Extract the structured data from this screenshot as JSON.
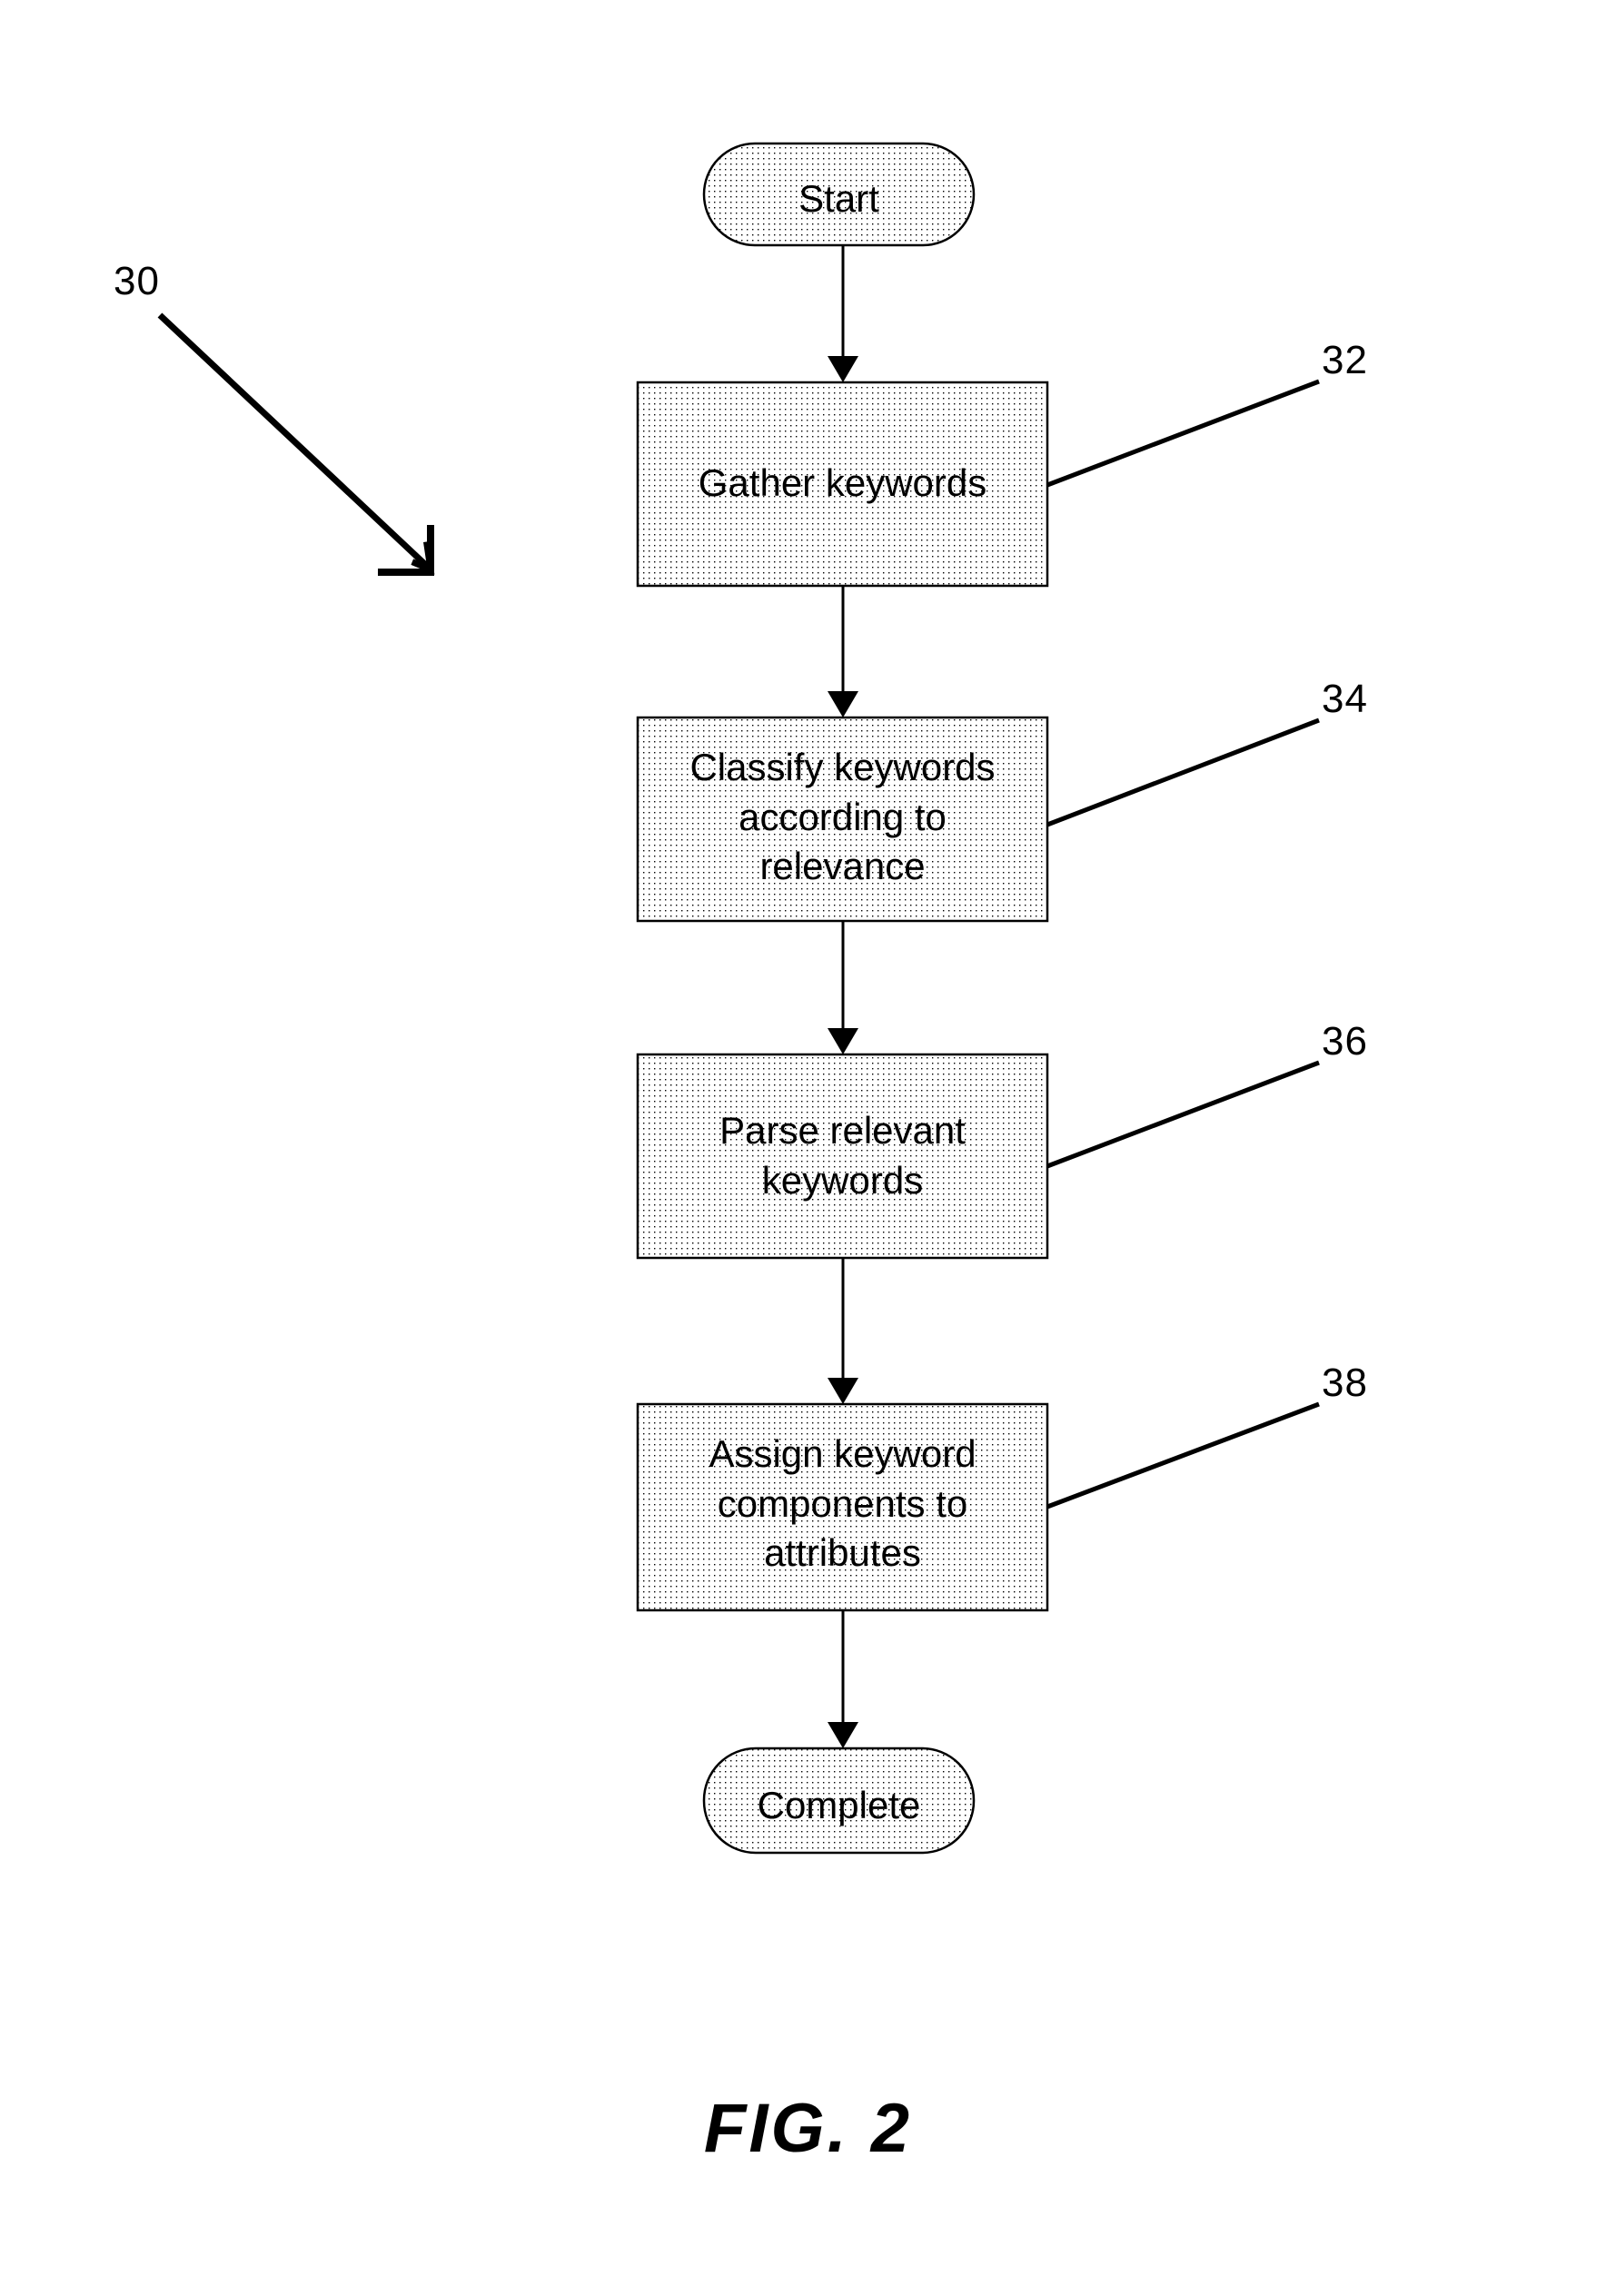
{
  "figure": {
    "caption": "FIG. 2",
    "assembly_numeral": "30"
  },
  "colors": {
    "ink": "#000000",
    "paper": "#ffffff",
    "fill_dot": "#000000"
  },
  "flowchart": {
    "type": "flowchart",
    "orientation": "top-to-bottom",
    "nodes": [
      {
        "id": "start",
        "shape": "terminator",
        "label": "Start",
        "numeral": null
      },
      {
        "id": "gather",
        "shape": "process",
        "label": "Gather keywords",
        "numeral": "32"
      },
      {
        "id": "classify",
        "shape": "process",
        "label": "Classify keywords\naccording to\nrelevance",
        "numeral": "34"
      },
      {
        "id": "parse",
        "shape": "process",
        "label": "Parse relevant\nkeywords",
        "numeral": "36"
      },
      {
        "id": "assign",
        "shape": "process",
        "label": "Assign keyword\ncomponents to\nattributes",
        "numeral": "38"
      },
      {
        "id": "complete",
        "shape": "terminator",
        "label": "Complete",
        "numeral": null
      }
    ],
    "edges": [
      {
        "from": "start",
        "to": "gather"
      },
      {
        "from": "gather",
        "to": "classify"
      },
      {
        "from": "classify",
        "to": "parse"
      },
      {
        "from": "parse",
        "to": "assign"
      },
      {
        "from": "assign",
        "to": "complete"
      }
    ]
  }
}
